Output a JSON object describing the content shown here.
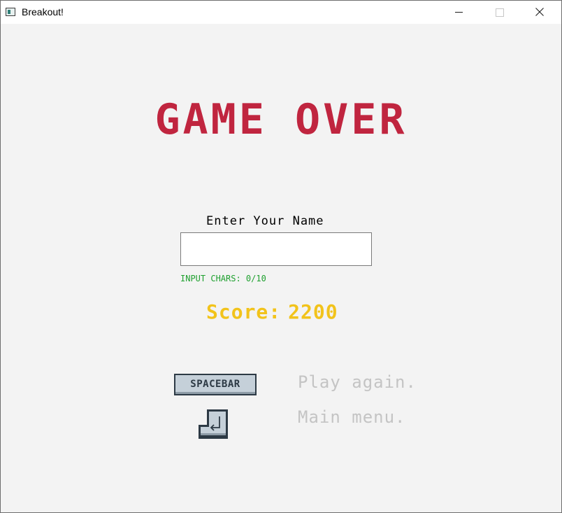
{
  "window": {
    "title": "Breakout!"
  },
  "game_over": {
    "heading": "GAME OVER",
    "name_prompt": "Enter Your Name",
    "name_input_value": "",
    "chars_counter": "INPUT CHARS: 0/10",
    "score_label": "Score:",
    "score_value": "2200"
  },
  "controls": {
    "spacebar_key_label": "SPACEBAR",
    "play_again_text": "Play again.",
    "main_menu_text": "Main menu."
  },
  "colors": {
    "heading": "#c0253f",
    "score": "#f2c31b",
    "counter": "#1fa02f",
    "hint": "#c4c4c4",
    "background": "#f3f3f3"
  },
  "icons": {
    "app": "app-window-icon",
    "enter_key": "enter-key-icon"
  }
}
